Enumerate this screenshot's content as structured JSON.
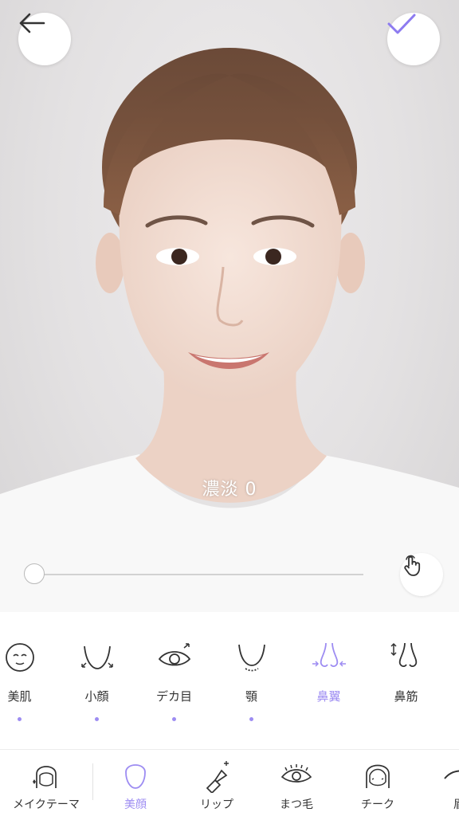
{
  "header": {
    "back_icon": "arrow-left-icon",
    "confirm_icon": "check-icon",
    "accent_color": "#9d8cf2"
  },
  "adjust": {
    "intensity_label": "濃淡 0",
    "slider_value": 0,
    "touch_icon": "hand-pointer-icon"
  },
  "features": [
    {
      "label": "美肌",
      "icon": "face-smooth-icon",
      "dot": true,
      "active": false
    },
    {
      "label": "小顔",
      "icon": "jaw-slim-icon",
      "dot": true,
      "active": false
    },
    {
      "label": "デカ目",
      "icon": "eye-enlarge-icon",
      "dot": true,
      "active": false
    },
    {
      "label": "顎",
      "icon": "chin-icon",
      "dot": true,
      "active": false
    },
    {
      "label": "鼻翼",
      "icon": "nose-wing-icon",
      "dot": false,
      "active": true
    },
    {
      "label": "鼻筋",
      "icon": "nose-bridge-icon",
      "dot": false,
      "active": false
    }
  ],
  "categories": [
    {
      "label": "メイクテーマ",
      "icon": "makeup-theme-icon",
      "active": false
    },
    {
      "label": "美顔",
      "icon": "face-outline-icon",
      "active": true
    },
    {
      "label": "リップ",
      "icon": "lipstick-icon",
      "active": false
    },
    {
      "label": "まつ毛",
      "icon": "eyelash-icon",
      "active": false
    },
    {
      "label": "チーク",
      "icon": "cheek-icon",
      "active": false
    },
    {
      "label": "眉",
      "icon": "eyebrow-icon",
      "active": false
    }
  ]
}
